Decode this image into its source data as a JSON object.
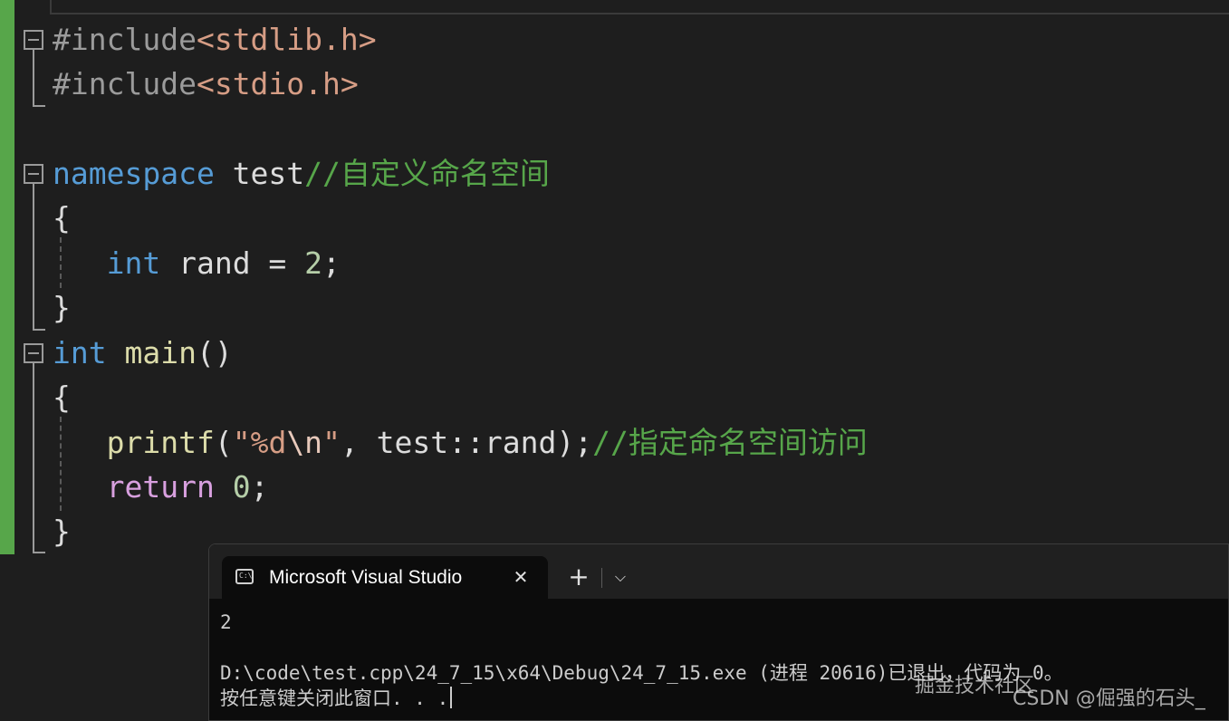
{
  "editor": {
    "lines": [
      {
        "tokens": [
          {
            "t": "#include",
            "c": "pre"
          },
          {
            "t": "<stdlib.h>",
            "c": "str"
          }
        ]
      },
      {
        "tokens": [
          {
            "t": "#include",
            "c": "pre"
          },
          {
            "t": "<stdio.h>",
            "c": "str"
          }
        ]
      },
      {
        "tokens": []
      },
      {
        "tokens": [
          {
            "t": "namespace",
            "c": "kw"
          },
          {
            "t": " test",
            "c": "id"
          },
          {
            "t": "//自定义命名空间",
            "c": "com"
          }
        ]
      },
      {
        "tokens": [
          {
            "t": "{",
            "c": "id"
          }
        ]
      },
      {
        "tokens": [
          {
            "t": "   ",
            "c": "id"
          },
          {
            "t": "int",
            "c": "kw"
          },
          {
            "t": " rand = ",
            "c": "id"
          },
          {
            "t": "2",
            "c": "num"
          },
          {
            "t": ";",
            "c": "id"
          }
        ]
      },
      {
        "tokens": [
          {
            "t": "}",
            "c": "id"
          }
        ]
      },
      {
        "tokens": [
          {
            "t": "int",
            "c": "kw"
          },
          {
            "t": " ",
            "c": "id"
          },
          {
            "t": "main",
            "c": "fn"
          },
          {
            "t": "()",
            "c": "id"
          }
        ]
      },
      {
        "tokens": [
          {
            "t": "{",
            "c": "id"
          }
        ]
      },
      {
        "tokens": [
          {
            "t": "   ",
            "c": "id"
          },
          {
            "t": "printf",
            "c": "fn"
          },
          {
            "t": "(",
            "c": "id"
          },
          {
            "t": "\"%d",
            "c": "str"
          },
          {
            "t": "\\n",
            "c": "esc"
          },
          {
            "t": "\"",
            "c": "str"
          },
          {
            "t": ", test::rand);",
            "c": "id"
          },
          {
            "t": "//指定命名空间访问",
            "c": "com"
          }
        ]
      },
      {
        "tokens": [
          {
            "t": "   ",
            "c": "id"
          },
          {
            "t": "return",
            "c": "ctl"
          },
          {
            "t": " ",
            "c": "id"
          },
          {
            "t": "0",
            "c": "num"
          },
          {
            "t": ";",
            "c": "id"
          }
        ]
      },
      {
        "tokens": [
          {
            "t": "}",
            "c": "id"
          }
        ]
      }
    ]
  },
  "terminal": {
    "tab_icon": "console-icon",
    "tab_title": "Microsoft Visual Studio",
    "close_symbol": "✕",
    "new_tab_symbol": "+",
    "dropdown_symbol": "⌵",
    "output": [
      "2",
      "",
      "D:\\code\\test.cpp\\24_7_15\\x64\\Debug\\24_7_15.exe (进程 20616)已退出，代码为 0。",
      "按任意键关闭此窗口. . ."
    ]
  },
  "watermark": {
    "line1": "掘金技术社区",
    "line2": "CSDN @倔强的石头_"
  }
}
